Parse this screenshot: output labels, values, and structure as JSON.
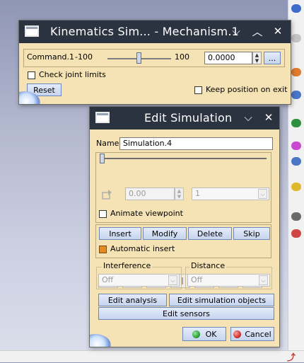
{
  "kinematics": {
    "title": "Kinematics Sim... - Mechanism.1",
    "command_label": "Command.1",
    "min": "-100",
    "max": "100",
    "value": "0.0000",
    "more_button": "...",
    "check_joint_limits": "Check joint limits",
    "reset": "Reset",
    "keep_position": "Keep position on exit"
  },
  "edit": {
    "title": "Edit Simulation",
    "name_label": "Name:",
    "name_value": "Simulation.4",
    "step_value": "0.00",
    "step_count": "1",
    "animate_viewpoint": "Animate viewpoint",
    "insert": "Insert",
    "modify": "Modify",
    "delete": "Delete",
    "skip": "Skip",
    "automatic_insert": "Automatic insert",
    "interference_label": "Interference",
    "interference_value": "Off",
    "distance_label": "Distance",
    "distance_value": "Off",
    "edit_analysis": "Edit analysis",
    "edit_sim_objects": "Edit simulation objects",
    "edit_sensors": "Edit sensors",
    "ok": "OK",
    "cancel": "Cancel"
  },
  "colors": {
    "panel": "#f6e3b5",
    "titlebar": "#2b3240",
    "button_face": "#d0dcf2",
    "button_border": "#6d87b7",
    "accent_orange": "#e58a1f",
    "ok_green": "#2fa33a",
    "cancel_red": "#d3312f"
  }
}
